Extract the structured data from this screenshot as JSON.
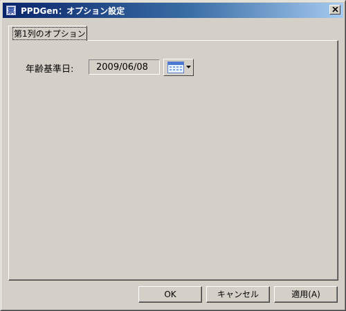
{
  "window": {
    "title": "PPDGen：オプション設定",
    "app_icon_glyph": "票"
  },
  "tabs": [
    {
      "label": "第1列のオプション",
      "selected": true
    }
  ],
  "options": {
    "base_date_label": "年齢基準日:",
    "base_date_value": "2009/06/08"
  },
  "buttons": {
    "ok": "OK",
    "cancel": "キャンセル",
    "apply": "適用(A)"
  },
  "icons": {
    "app": "app-icon",
    "close": "close-icon",
    "calendar": "calendar-icon",
    "dropdown": "chevron-down-icon"
  }
}
